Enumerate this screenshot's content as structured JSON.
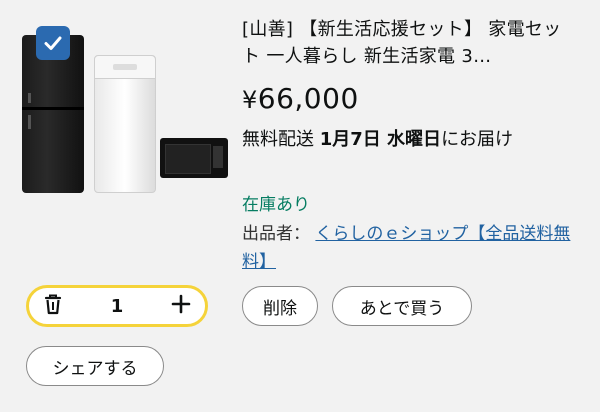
{
  "item": {
    "selected": true,
    "title": "[山善] 【新生活応援セット】 家電セット 一人暮らし 新生活家電 3…",
    "price_symbol": "¥",
    "price_value": "66,000",
    "shipping_prefix": "無料配送",
    "shipping_date": "1月7日 水曜日",
    "shipping_suffix": "にお届け",
    "stock": "在庫あり",
    "seller_label": "出品者：",
    "seller_name": "くらしのｅショップ【全品送料無料】"
  },
  "quantity": {
    "value": "1",
    "delete_icon": "trash-icon",
    "increment_icon": "plus-icon"
  },
  "actions": {
    "delete_label": "削除",
    "save_later_label": "あとで買う",
    "share_label": "シェアする"
  },
  "colors": {
    "checkbox": "#2b6ab0",
    "stepper_border": "#f5d33a",
    "stock_text": "#067d62",
    "link": "#2162a1"
  }
}
